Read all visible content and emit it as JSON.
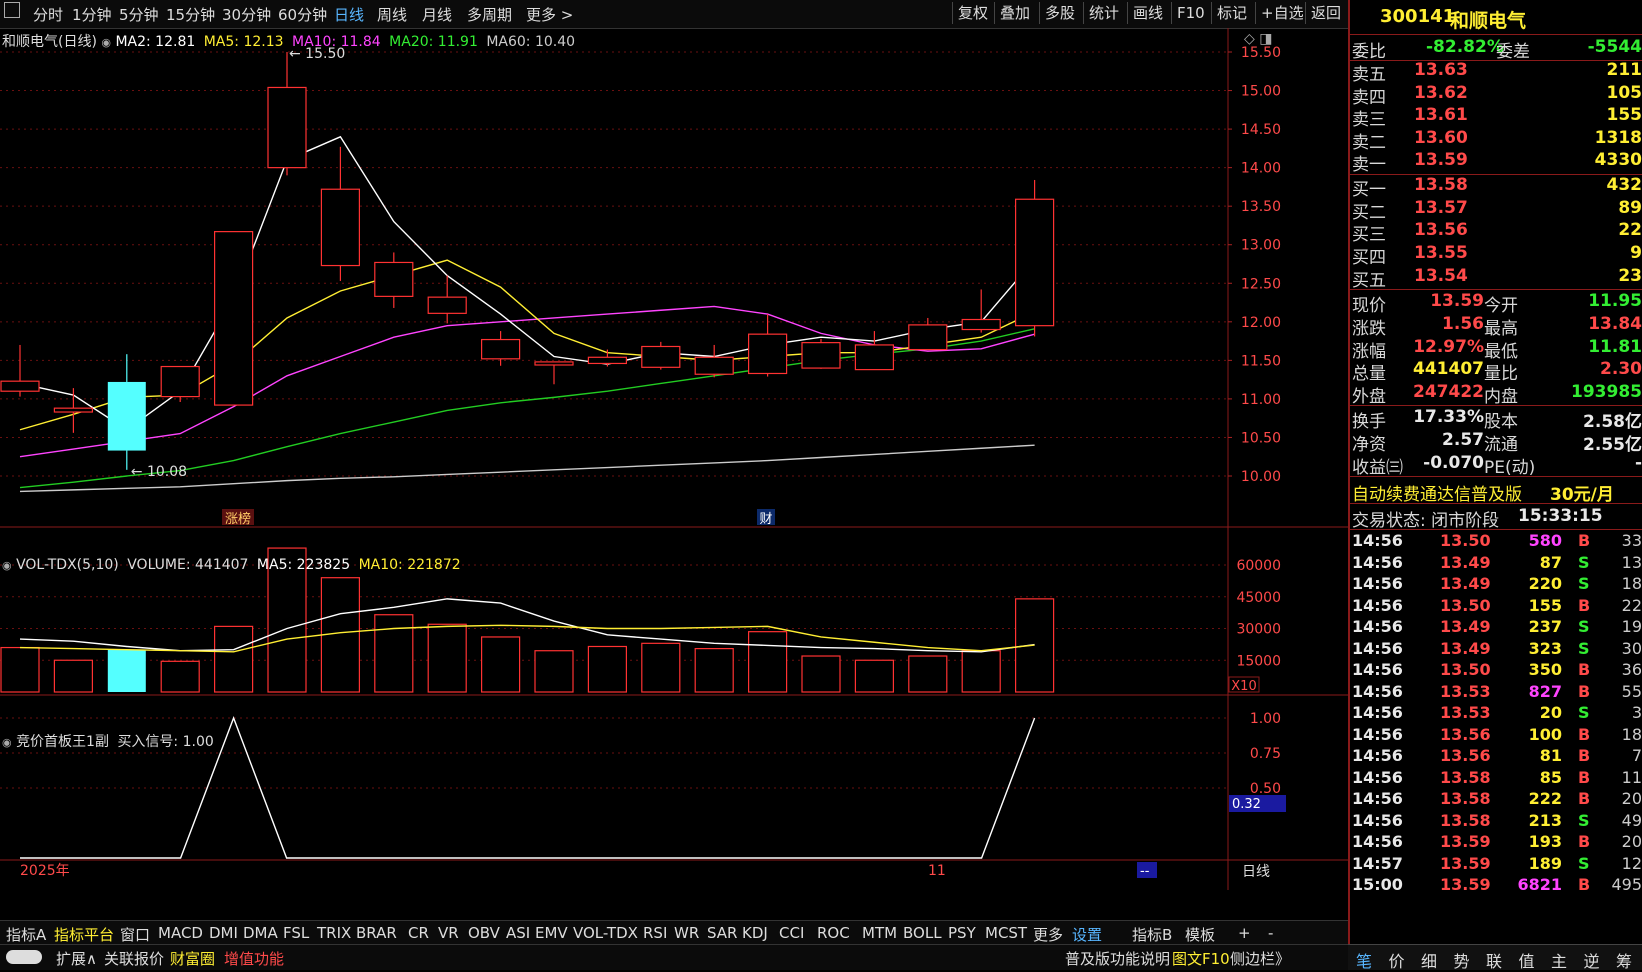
{
  "toolbar": {
    "left": [
      "分时",
      "1分钟",
      "5分钟",
      "15分钟",
      "30分钟",
      "60分钟",
      "日线",
      "周线",
      "月线",
      "多周期",
      "更多 >"
    ],
    "active": "日线",
    "right": [
      "复权",
      "叠加",
      "多股",
      "统计",
      "画线",
      "F10",
      "标记",
      "+自选",
      "返回"
    ]
  },
  "main_legend": {
    "title": "和顺电气(日线)",
    "ma2": "MA2: 12.81",
    "ma5": "MA5: 12.13",
    "ma10": "MA10: 11.84",
    "ma20": "MA20: 11.91",
    "ma60": "MA60: 10.40",
    "high_label": "15.50",
    "low_label": "10.08",
    "marker1": "涨榜",
    "marker2": "财"
  },
  "vol_legend": {
    "name": "VOL-TDX(5,10)",
    "volume": "VOLUME: 441407",
    "ma5": "MA5: 223825",
    "ma10": "MA10: 221872",
    "unit": "X10"
  },
  "ind_legend": {
    "name": "竞价首板王1副",
    "signal": "买入信号: 1.00",
    "cursor_value": "0.32"
  },
  "axis": {
    "year": "2025年",
    "month": "11",
    "period": "日线",
    "dash": "--"
  },
  "chart_data": {
    "type": "candlestick",
    "price_axis": [
      "15.50",
      "15.00",
      "14.50",
      "14.00",
      "13.50",
      "13.00",
      "12.50",
      "12.00",
      "11.50",
      "11.00",
      "10.50",
      "10.00"
    ],
    "vol_axis": [
      "60000",
      "45000",
      "30000",
      "15000"
    ],
    "ind_axis": [
      "1.00",
      "0.75",
      "0.50"
    ],
    "candles": [
      {
        "o": 11.1,
        "c": 11.23,
        "h": 11.7,
        "l": 11.03
      },
      {
        "o": 10.83,
        "c": 10.88,
        "h": 11.14,
        "l": 10.56
      },
      {
        "o": 11.22,
        "c": 10.33,
        "h": 11.58,
        "l": 10.08
      },
      {
        "o": 11.03,
        "c": 11.42,
        "h": 11.42,
        "l": 10.96
      },
      {
        "o": 10.92,
        "c": 13.17,
        "h": 13.17,
        "l": 10.92
      },
      {
        "o": 14.0,
        "c": 15.04,
        "h": 15.5,
        "l": 13.9
      },
      {
        "o": 12.73,
        "c": 13.72,
        "h": 14.27,
        "l": 12.53
      },
      {
        "o": 12.33,
        "c": 12.77,
        "h": 12.9,
        "l": 12.18
      },
      {
        "o": 12.11,
        "c": 12.32,
        "h": 12.6,
        "l": 11.98
      },
      {
        "o": 11.52,
        "c": 11.77,
        "h": 11.88,
        "l": 11.43
      },
      {
        "o": 11.44,
        "c": 11.48,
        "h": 11.48,
        "l": 11.19
      },
      {
        "o": 11.46,
        "c": 11.54,
        "h": 11.64,
        "l": 11.42
      },
      {
        "o": 11.41,
        "c": 11.68,
        "h": 11.74,
        "l": 11.38
      },
      {
        "o": 11.32,
        "c": 11.54,
        "h": 11.7,
        "l": 11.28
      },
      {
        "o": 11.33,
        "c": 11.84,
        "h": 12.1,
        "l": 11.29
      },
      {
        "o": 11.4,
        "c": 11.73,
        "h": 11.78,
        "l": 11.39
      },
      {
        "o": 11.38,
        "c": 11.7,
        "h": 11.88,
        "l": 11.38
      },
      {
        "o": 11.64,
        "c": 11.96,
        "h": 12.05,
        "l": 11.64
      },
      {
        "o": 11.9,
        "c": 12.03,
        "h": 12.42,
        "l": 11.86
      },
      {
        "o": 11.95,
        "c": 13.59,
        "h": 13.84,
        "l": 11.81
      }
    ],
    "ma2": [
      11.2,
      11.05,
      10.6,
      11.1,
      12.3,
      14.1,
      14.4,
      13.3,
      12.6,
      12.1,
      11.55,
      11.45,
      11.6,
      11.55,
      11.7,
      11.8,
      11.75,
      11.9,
      12.0,
      12.81
    ],
    "ma5": [
      10.6,
      10.8,
      11.02,
      11.05,
      11.45,
      12.05,
      12.4,
      12.6,
      12.8,
      12.45,
      11.85,
      11.6,
      11.55,
      11.5,
      11.55,
      11.6,
      11.6,
      11.7,
      11.8,
      12.13
    ],
    "ma10": [
      10.25,
      10.35,
      10.45,
      10.55,
      10.9,
      11.3,
      11.55,
      11.8,
      11.95,
      12.0,
      12.05,
      12.1,
      12.15,
      12.2,
      12.1,
      11.85,
      11.7,
      11.62,
      11.65,
      11.84
    ],
    "ma20": [
      9.85,
      9.92,
      10.0,
      10.07,
      10.2,
      10.38,
      10.55,
      10.7,
      10.85,
      10.95,
      11.02,
      11.1,
      11.2,
      11.3,
      11.4,
      11.5,
      11.58,
      11.65,
      11.75,
      11.91
    ],
    "ma60": [
      9.8,
      9.82,
      9.84,
      9.86,
      9.9,
      9.94,
      9.97,
      9.99,
      10.02,
      10.05,
      10.08,
      10.11,
      10.14,
      10.17,
      10.2,
      10.24,
      10.28,
      10.32,
      10.36,
      10.4
    ],
    "volumes": [
      21000,
      15000,
      20000,
      14500,
      31000,
      68000,
      54000,
      36500,
      32000,
      26000,
      19500,
      21500,
      23000,
      20500,
      28500,
      17000,
      15000,
      17000,
      19500,
      44000
    ],
    "vol_ma5": [
      25000,
      24000,
      21500,
      19500,
      20000,
      30000,
      37000,
      40000,
      44000,
      42000,
      33500,
      27000,
      25000,
      23000,
      22000,
      21000,
      20500,
      19500,
      19000,
      22400
    ],
    "vol_ma10": [
      21000,
      20500,
      20000,
      19500,
      19000,
      25000,
      28000,
      30000,
      31000,
      31500,
      31000,
      30000,
      30000,
      30500,
      31000,
      26000,
      23500,
      21000,
      19500,
      22200
    ],
    "signal": [
      0,
      0,
      0,
      0,
      1,
      0,
      0,
      0,
      0,
      0,
      0,
      0,
      0,
      0,
      0,
      0,
      0,
      0,
      0,
      1
    ]
  },
  "panel": {
    "code": "300141",
    "name": "和顺电气",
    "weibi_label": "委比",
    "weibi": "-82.82%",
    "weicha_label": "委差",
    "weicha": "-5544",
    "asks": [
      {
        "label": "卖五",
        "price": "13.63",
        "vol": "211"
      },
      {
        "label": "卖四",
        "price": "13.62",
        "vol": "105"
      },
      {
        "label": "卖三",
        "price": "13.61",
        "vol": "155"
      },
      {
        "label": "卖二",
        "price": "13.60",
        "vol": "1318"
      },
      {
        "label": "卖一",
        "price": "13.59",
        "vol": "4330"
      }
    ],
    "bids": [
      {
        "label": "买一",
        "price": "13.58",
        "vol": "432"
      },
      {
        "label": "买二",
        "price": "13.57",
        "vol": "89"
      },
      {
        "label": "买三",
        "price": "13.56",
        "vol": "22"
      },
      {
        "label": "买四",
        "price": "13.55",
        "vol": "9"
      },
      {
        "label": "买五",
        "price": "13.54",
        "vol": "23"
      }
    ],
    "quote": [
      {
        "l1": "现价",
        "v1": "13.59",
        "c1": "red",
        "l2": "今开",
        "v2": "11.95",
        "c2": "green"
      },
      {
        "l1": "涨跌",
        "v1": "1.56",
        "c1": "red",
        "l2": "最高",
        "v2": "13.84",
        "c2": "red"
      },
      {
        "l1": "涨幅",
        "v1": "12.97%",
        "c1": "red",
        "l2": "最低",
        "v2": "11.81",
        "c2": "green"
      },
      {
        "l1": "总量",
        "v1": "441407",
        "c1": "yellow",
        "l2": "量比",
        "v2": "2.30",
        "c2": "red"
      },
      {
        "l1": "外盘",
        "v1": "247422",
        "c1": "red",
        "l2": "内盘",
        "v2": "193985",
        "c2": "green"
      }
    ],
    "fund": [
      {
        "l1": "换手",
        "v1": "17.33%",
        "l2": "股本",
        "v2": "2.58亿"
      },
      {
        "l1": "净资",
        "v1": "2.57",
        "l2": "流通",
        "v2": "2.55亿"
      },
      {
        "l1": "收益㈢",
        "v1": "-0.070",
        "l2": "PE(动)",
        "v2": "-"
      }
    ],
    "promo": "自动续费通达信普及版",
    "promo_price": "30元/月",
    "status": "交易状态: 闭市阶段",
    "status_time": "15:33:15",
    "ticks": [
      {
        "t": "14:56",
        "p": "13.50",
        "v": "580",
        "d": "B",
        "n": "33",
        "vc": "magenta"
      },
      {
        "t": "14:56",
        "p": "13.49",
        "v": "87",
        "d": "S",
        "n": "13",
        "vc": "yellow"
      },
      {
        "t": "14:56",
        "p": "13.49",
        "v": "220",
        "d": "S",
        "n": "18",
        "vc": "yellow"
      },
      {
        "t": "14:56",
        "p": "13.50",
        "v": "155",
        "d": "B",
        "n": "22",
        "vc": "yellow"
      },
      {
        "t": "14:56",
        "p": "13.49",
        "v": "237",
        "d": "S",
        "n": "19",
        "vc": "yellow"
      },
      {
        "t": "14:56",
        "p": "13.49",
        "v": "323",
        "d": "S",
        "n": "30",
        "vc": "yellow"
      },
      {
        "t": "14:56",
        "p": "13.50",
        "v": "350",
        "d": "B",
        "n": "36",
        "vc": "yellow"
      },
      {
        "t": "14:56",
        "p": "13.53",
        "v": "827",
        "d": "B",
        "n": "55",
        "vc": "magenta"
      },
      {
        "t": "14:56",
        "p": "13.53",
        "v": "20",
        "d": "S",
        "n": "3",
        "vc": "yellow"
      },
      {
        "t": "14:56",
        "p": "13.56",
        "v": "100",
        "d": "B",
        "n": "18",
        "vc": "yellow"
      },
      {
        "t": "14:56",
        "p": "13.56",
        "v": "81",
        "d": "B",
        "n": "7",
        "vc": "yellow"
      },
      {
        "t": "14:56",
        "p": "13.58",
        "v": "85",
        "d": "B",
        "n": "11",
        "vc": "yellow"
      },
      {
        "t": "14:56",
        "p": "13.58",
        "v": "222",
        "d": "B",
        "n": "20",
        "vc": "yellow"
      },
      {
        "t": "14:56",
        "p": "13.58",
        "v": "213",
        "d": "S",
        "n": "49",
        "vc": "yellow"
      },
      {
        "t": "14:56",
        "p": "13.59",
        "v": "193",
        "d": "B",
        "n": "20",
        "vc": "yellow"
      },
      {
        "t": "14:57",
        "p": "13.59",
        "v": "189",
        "d": "S",
        "n": "12",
        "vc": "yellow"
      },
      {
        "t": "15:00",
        "p": "13.59",
        "v": "6821",
        "d": "B",
        "n": "495",
        "vc": "magenta"
      }
    ],
    "bottom_tabs": [
      "笔",
      "价",
      "细",
      "势",
      "联",
      "值",
      "主",
      "逆",
      "筹"
    ]
  },
  "indicator_tabs": [
    "指标A",
    "指标平台",
    "窗口",
    "MACD",
    "DMI",
    "DMA",
    "FSL",
    "TRIX",
    "BRAR",
    "CR",
    "VR",
    "OBV",
    "ASI",
    "EMV",
    "VOL-TDX",
    "RSI",
    "WR",
    "SAR",
    "KDJ",
    "CCI",
    "ROC",
    "MTM",
    "BOLL",
    "PSY",
    "MCST",
    "更多",
    "设置",
    "指标B",
    "模板",
    "+",
    "-"
  ],
  "bottom_bar": {
    "expand": "扩展∧",
    "related": "关联报价",
    "fortune": "财富圈",
    "value_add": "增值功能",
    "help": "普及版功能说明",
    "f10": "图文F10",
    "sidebar": "侧边栏》"
  },
  "colors": {
    "up": "#ff3232",
    "down": "#54ffff",
    "ma2": "#ffffff",
    "ma5": "#ffee33",
    "ma10": "#ff44ff",
    "ma20": "#22cc22",
    "ma60": "#cccccc",
    "accent": "#58b6ff"
  }
}
